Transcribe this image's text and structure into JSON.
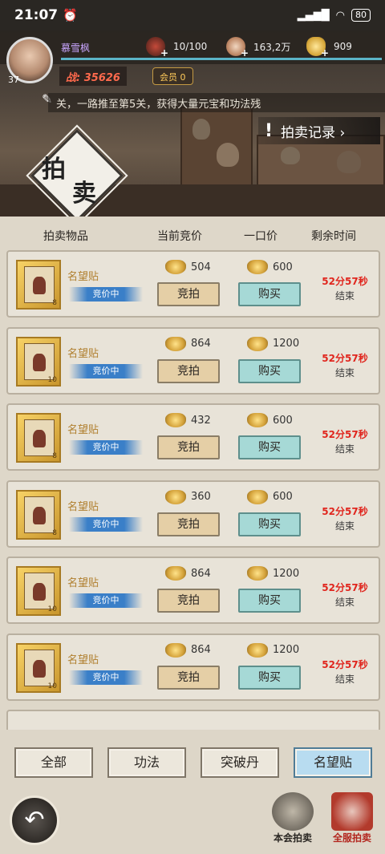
{
  "status_bar": {
    "time": "21:07",
    "alarm_icon": "alarm-icon",
    "signal": "▮▮▮ ▮▮▮",
    "wifi": "wifi-icon",
    "battery": "80"
  },
  "player": {
    "name": "慕雪枫",
    "level": "37",
    "power": "战: 35626",
    "vip": "会员 0"
  },
  "resources": {
    "energy": "10/100",
    "coins": "163,2万",
    "gold": "909"
  },
  "marquee": "关，一路推至第5关，获得大量元宝和功法残",
  "auction": {
    "title_1": "拍",
    "title_2": "卖",
    "record_button": "拍卖记录 ›"
  },
  "table": {
    "headers": [
      "拍卖物品",
      "当前竞价",
      "一口价",
      "剩余时间"
    ],
    "rows": [
      {
        "name": "名望贴",
        "status": "竞价中",
        "bid_price": "504",
        "buy_price": "600",
        "bid_label": "竞拍",
        "buy_label": "购买",
        "time_left": "52分57秒",
        "end_label": "结束",
        "level": "8"
      },
      {
        "name": "名望贴",
        "status": "竞价中",
        "bid_price": "864",
        "buy_price": "1200",
        "bid_label": "竞拍",
        "buy_label": "购买",
        "time_left": "52分57秒",
        "end_label": "结束",
        "level": "10"
      },
      {
        "name": "名望贴",
        "status": "竞价中",
        "bid_price": "432",
        "buy_price": "600",
        "bid_label": "竞拍",
        "buy_label": "购买",
        "time_left": "52分57秒",
        "end_label": "结束",
        "level": "8"
      },
      {
        "name": "名望贴",
        "status": "竞价中",
        "bid_price": "360",
        "buy_price": "600",
        "bid_label": "竞拍",
        "buy_label": "购买",
        "time_left": "52分57秒",
        "end_label": "结束",
        "level": "8"
      },
      {
        "name": "名望贴",
        "status": "竞价中",
        "bid_price": "864",
        "buy_price": "1200",
        "bid_label": "竞拍",
        "buy_label": "购买",
        "time_left": "52分57秒",
        "end_label": "结束",
        "level": "10"
      },
      {
        "name": "名望贴",
        "status": "竞价中",
        "bid_price": "864",
        "buy_price": "1200",
        "bid_label": "竞拍",
        "buy_label": "购买",
        "time_left": "52分57秒",
        "end_label": "结束",
        "level": "10"
      }
    ]
  },
  "filters": [
    "全部",
    "功法",
    "突破丹",
    "名望贴"
  ],
  "active_filter": "名望贴",
  "bottom_nav": {
    "back_icon": "back-arrow-icon",
    "local_label": "本会拍卖",
    "global_label": "全服拍卖"
  },
  "colors": {
    "time_red": "#e0261e",
    "buy_button": "#a6d9d6",
    "bid_button": "#e5cfa6",
    "active_tab": "#b8dcf0"
  }
}
